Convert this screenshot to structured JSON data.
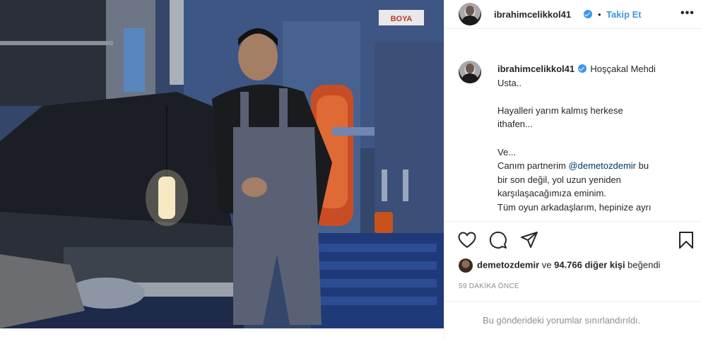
{
  "post": {
    "username": "ibrahimcelikkol41",
    "separator": "•",
    "follow_label": "Takip Et",
    "more_label": "•••",
    "caption": {
      "username": "ibrahimcelikkol41",
      "line1": "Hoşçakal Mehdi",
      "line2": "Usta..",
      "line3": "Hayalleri yarım kalmış herkese",
      "line4": "ithafen...",
      "line5": "Ve...",
      "line6_before": "Canım partnerim ",
      "mention": "@demetozdemir",
      "line6_after": " bu",
      "line7": "bir son değil, yol uzun yeniden",
      "line8": "karşılaşacağımıza eminim.",
      "line9": "Tüm oyun arkadaşlarım, hepinize ayrı"
    },
    "likes": {
      "liker": "demetozdemir",
      "connector": " ve ",
      "others": "94.766 diğer kişi",
      "suffix": " beğendi"
    },
    "time_ago": "59 DAKİKA ÖNCE",
    "comments_restricted": "Bu gönderideki yorumlar sınırlandırıldı.",
    "photo_sign": "BOYA"
  },
  "icons": {
    "like": "heart-icon",
    "comment": "comment-icon",
    "share": "share-icon",
    "save": "bookmark-icon",
    "verified": "verified-badge-icon"
  },
  "colors": {
    "link_blue": "#3897f0",
    "mention_blue": "#00376b",
    "muted_gray": "#8e8e8e"
  }
}
